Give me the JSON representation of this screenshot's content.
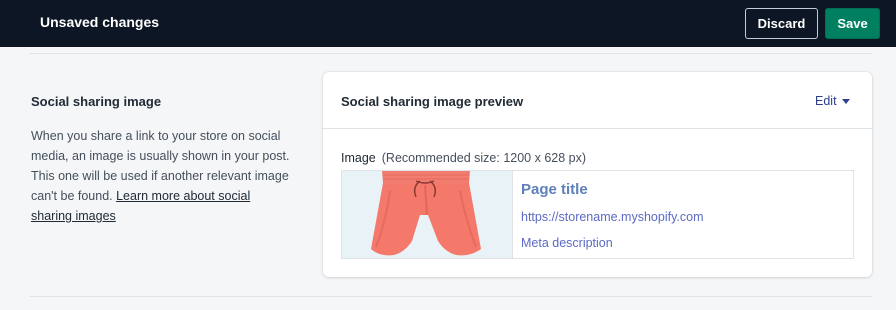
{
  "topbar": {
    "title": "Unsaved changes",
    "discard_label": "Discard",
    "save_label": "Save"
  },
  "section": {
    "title": "Social sharing image",
    "description": "When you share a link to your store on social media, an image is usually shown in your post. This one will be used if another relevant image can't be found.",
    "learn_more_link": "Learn more about social sharing images"
  },
  "card": {
    "title": "Social sharing image preview",
    "edit_label": "Edit",
    "edit_icon": "caret-down-icon",
    "image_label": "Image",
    "image_hint": "(Recommended size: 1200 x 628 px)",
    "preview": {
      "image": "coral-shorts-product-image",
      "page_title": "Page title",
      "url": "https://storename.myshopify.com",
      "meta_description": "Meta description"
    }
  },
  "colors": {
    "topbar_bg": "#0d1624",
    "save_button": "#008060",
    "page_bg": "#f4f6f8",
    "link_blue": "#5c6ac4",
    "product_coral": "#f4796b"
  }
}
